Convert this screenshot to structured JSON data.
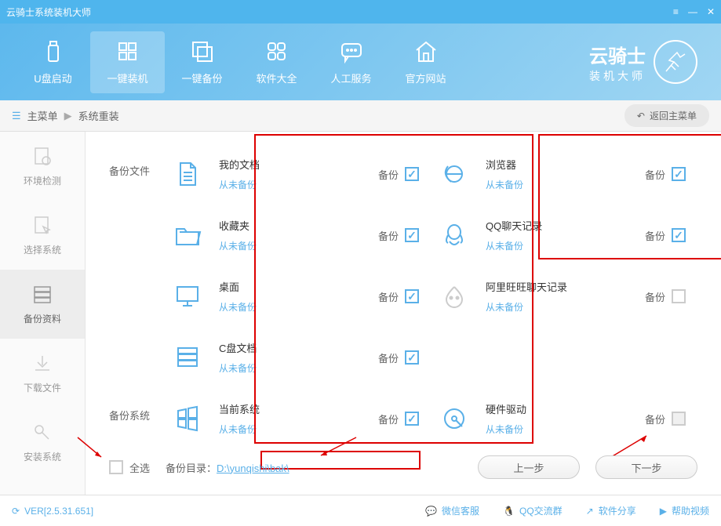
{
  "title": "云骑士系统装机大师",
  "nav": [
    {
      "label": "U盘启动",
      "name": "usb-boot"
    },
    {
      "label": "一键装机",
      "name": "one-click-install"
    },
    {
      "label": "一键备份",
      "name": "one-click-backup"
    },
    {
      "label": "软件大全",
      "name": "software-store"
    },
    {
      "label": "人工服务",
      "name": "support"
    },
    {
      "label": "官方网站",
      "name": "official-site"
    }
  ],
  "logo": {
    "big": "云骑士",
    "small": "装机大师"
  },
  "breadcrumb": {
    "main": "主菜单",
    "current": "系统重装"
  },
  "back_button": "返回主菜单",
  "sidebar": [
    {
      "label": "环境检测"
    },
    {
      "label": "选择系统"
    },
    {
      "label": "备份资料"
    },
    {
      "label": "下载文件"
    },
    {
      "label": "安装系统"
    }
  ],
  "sections": {
    "files_label": "备份文件",
    "system_label": "备份系统"
  },
  "items_left": [
    {
      "title": "我的文档",
      "status": "从未备份",
      "checked": true
    },
    {
      "title": "收藏夹",
      "status": "从未备份",
      "checked": true
    },
    {
      "title": "桌面",
      "status": "从未备份",
      "checked": true
    },
    {
      "title": "C盘文档",
      "status": "从未备份",
      "checked": true
    },
    {
      "title": "当前系统",
      "status": "从未备份",
      "checked": true
    }
  ],
  "items_right": [
    {
      "title": "浏览器",
      "status": "从未备份",
      "checked": true
    },
    {
      "title": "QQ聊天记录",
      "status": "从未备份",
      "checked": true
    },
    {
      "title": "阿里旺旺聊天记录",
      "status": "从未备份",
      "checked": false
    },
    {
      "title": "硬件驱动",
      "status": "从未备份",
      "checked": "grayed"
    }
  ],
  "backup_label": "备份",
  "select_all": "全选",
  "path_label": "备份目录：",
  "path_value": "D:\\yunqishi\\bak\\",
  "prev_btn": "上一步",
  "next_btn": "下一步",
  "footer": {
    "version": "VER[2.5.31.651]",
    "items": [
      "微信客服",
      "QQ交流群",
      "软件分享",
      "帮助视频"
    ]
  }
}
